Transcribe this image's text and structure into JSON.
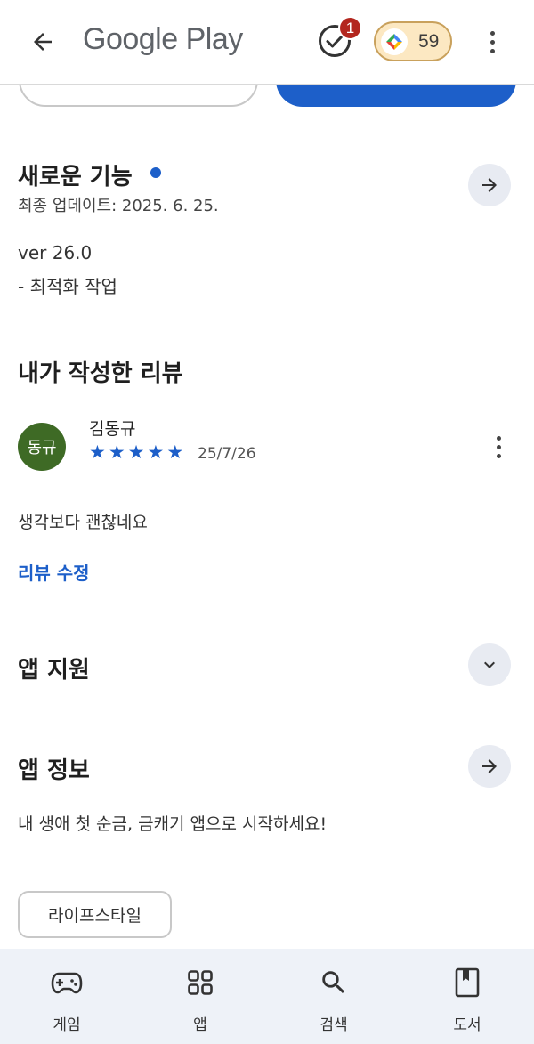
{
  "header": {
    "brand": "Google Play",
    "notification_count": "1",
    "points": "59"
  },
  "whats_new": {
    "title": "새로운 기능",
    "updated": "최종 업데이트: 2025. 6. 25.",
    "version": "ver 26.0",
    "note": "- 최적화 작업"
  },
  "my_review": {
    "title": "내가 작성한 리뷰",
    "avatar_text": "동규",
    "reviewer": "김동규",
    "stars": 5,
    "date": "25/7/26",
    "text": "생각보다 괜찮네요",
    "edit_link": "리뷰 수정"
  },
  "app_support": {
    "title": "앱 지원"
  },
  "app_info": {
    "title": "앱 정보",
    "description": "내 생애 첫 순금, 금캐기 앱으로 시작하세요!",
    "category_chip": "라이프스타일"
  },
  "bottom_nav": {
    "items": [
      {
        "label": "게임",
        "icon": "gamepad-icon"
      },
      {
        "label": "앱",
        "icon": "apps-grid-icon"
      },
      {
        "label": "검색",
        "icon": "search-icon"
      },
      {
        "label": "도서",
        "icon": "book-icon"
      }
    ]
  },
  "colors": {
    "accent": "#1d5fc9",
    "avatar_bg": "#3e6a25",
    "badge": "#b3261e",
    "points_bg": "#fce8c2",
    "nav_bg": "#eef2f8"
  }
}
